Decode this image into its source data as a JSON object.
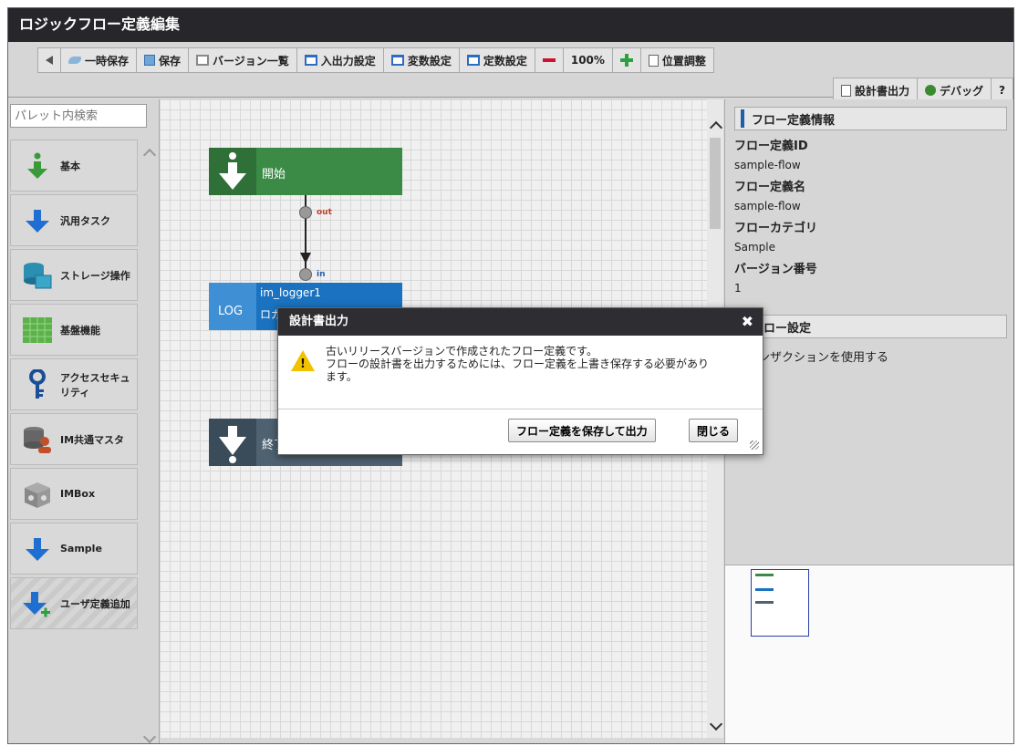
{
  "window": {
    "title": "ロジックフロー定義編集"
  },
  "toolbar": {
    "back_icon": "arrow-left-icon",
    "temp_save": "一時保存",
    "save": "保存",
    "version_list": "バージョン一覧",
    "io_settings": "入出力設定",
    "var_settings": "変数設定",
    "const_settings": "定数設定",
    "zoom": "100%",
    "position_adjust": "位置調整",
    "design_output": "設計書出力",
    "debug": "デバッグ",
    "help": "?"
  },
  "palette": {
    "search_placeholder": "パレット内検索",
    "items": [
      {
        "label": "基本",
        "icon": "arrow-down-green-icon"
      },
      {
        "label": "汎用タスク",
        "icon": "arrow-down-blue-icon"
      },
      {
        "label": "ストレージ操作",
        "icon": "storage-icon"
      },
      {
        "label": "基盤機能",
        "icon": "grid-icon"
      },
      {
        "label": "アクセスセキュリティ",
        "icon": "key-icon"
      },
      {
        "label": "IM共通マスタ",
        "icon": "database-user-icon"
      },
      {
        "label": "IMBox",
        "icon": "box-icon"
      },
      {
        "label": "Sample",
        "icon": "arrow-down-blue-icon"
      },
      {
        "label": "ユーザ定義追加",
        "icon": "arrow-down-plus-icon"
      }
    ]
  },
  "canvas": {
    "start_node": "開始",
    "log_node_id": "im_logger1",
    "log_node_icon": "LOG",
    "log_node_name": "ロガー",
    "end_node": "終了",
    "port_out": "out",
    "port_in": "in"
  },
  "right_panel": {
    "section1": "フロー定義情報",
    "flow_id_label": "フロー定義ID",
    "flow_id": "sample-flow",
    "flow_name_label": "フロー定義名",
    "flow_name": "sample-flow",
    "category_label": "フローカテゴリ",
    "category": "Sample",
    "version_label": "バージョン番号",
    "version": "1",
    "section2": "フロー設定",
    "transaction": "トランザクションを使用する"
  },
  "dialog": {
    "title": "設計書出力",
    "message_line1": "古いリリースバージョンで作成されたフロー定義です。",
    "message_line2": "フローの設計書を出力するためには、フロー定義を上書き保存する必要があります。",
    "save_output_button": "フロー定義を保存して出力",
    "close_button": "閉じる"
  }
}
